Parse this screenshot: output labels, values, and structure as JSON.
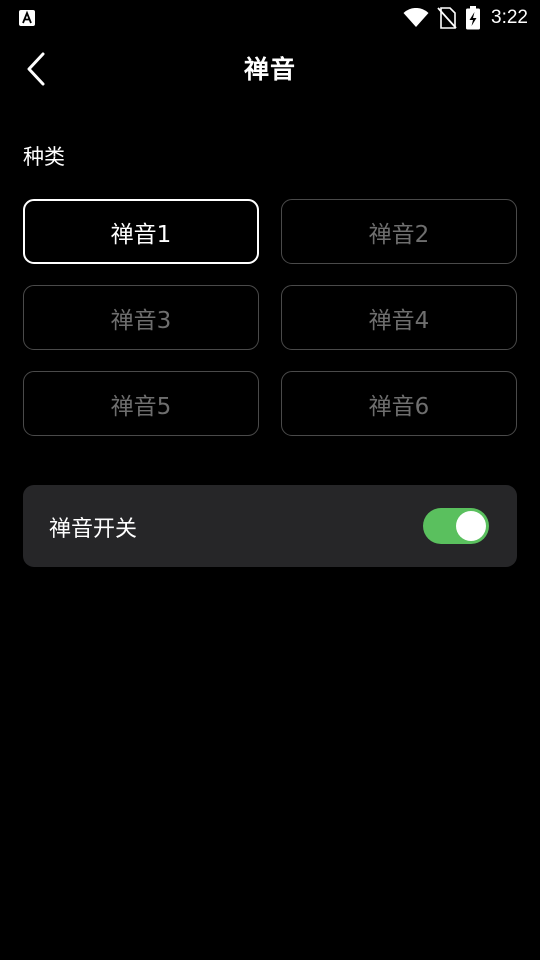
{
  "status_bar": {
    "time": "3:22",
    "icons": [
      "keyboard-a-icon",
      "wifi-icon",
      "no-sim-icon",
      "battery-charging-icon"
    ]
  },
  "header": {
    "title": "禅音",
    "back_icon": "chevron-left-icon"
  },
  "category": {
    "label": "种类",
    "options": [
      "禅音1",
      "禅音2",
      "禅音3",
      "禅音4",
      "禅音5",
      "禅音6"
    ],
    "selected_index": 0
  },
  "zen_switch": {
    "label": "禅音开关",
    "on": true
  },
  "colors": {
    "background": "#000000",
    "card": "#262628",
    "accent_green": "#5ac05e",
    "inactive_text": "#6e6e6e",
    "inactive_border": "#4a4a4a"
  }
}
